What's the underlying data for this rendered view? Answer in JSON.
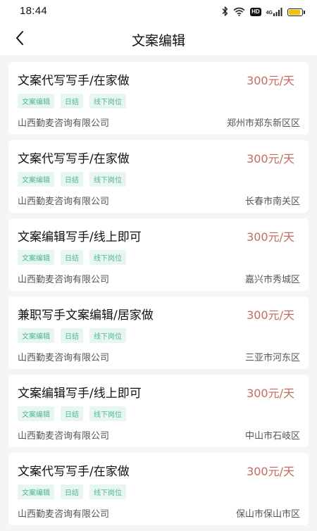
{
  "status_bar": {
    "time": "18:44",
    "hd_label": "HD",
    "signal_label": "4G",
    "battery_level": 0.9
  },
  "nav": {
    "title": "文案编辑"
  },
  "jobs": [
    {
      "title": "文案代写写手/在家做",
      "salary": "300元/天",
      "tags": [
        "文案编辑",
        "日结",
        "线下岗位"
      ],
      "company": "山西勤麦咨询有限公司",
      "location": "郑州市郑东新区区"
    },
    {
      "title": "文案代写写手/在家做",
      "salary": "300元/天",
      "tags": [
        "文案编辑",
        "日结",
        "线下岗位"
      ],
      "company": "山西勤麦咨询有限公司",
      "location": "长春市南关区"
    },
    {
      "title": "文案编辑写手/线上即可",
      "salary": "300元/天",
      "tags": [
        "文案编辑",
        "日结",
        "线下岗位"
      ],
      "company": "山西勤麦咨询有限公司",
      "location": "嘉兴市秀城区"
    },
    {
      "title": "兼职写手文案编辑/居家做",
      "salary": "300元/天",
      "tags": [
        "文案编辑",
        "日结",
        "线下岗位"
      ],
      "company": "山西勤麦咨询有限公司",
      "location": "三亚市河东区"
    },
    {
      "title": "文案编辑写手/线上即可",
      "salary": "300元/天",
      "tags": [
        "文案编辑",
        "日结",
        "线下岗位"
      ],
      "company": "山西勤麦咨询有限公司",
      "location": "中山市石岐区"
    },
    {
      "title": "文案代写写手/在家做",
      "salary": "300元/天",
      "tags": [
        "文案编辑",
        "日结",
        "线下岗位"
      ],
      "company": "山西勤麦咨询有限公司",
      "location": "保山市保山市区"
    }
  ],
  "colors": {
    "salary": "#c46b5f",
    "tag_text": "#4fb399",
    "tag_bg": "#e7f6f1",
    "page_bg": "#f5f5f5",
    "battery": "#f2c200"
  }
}
